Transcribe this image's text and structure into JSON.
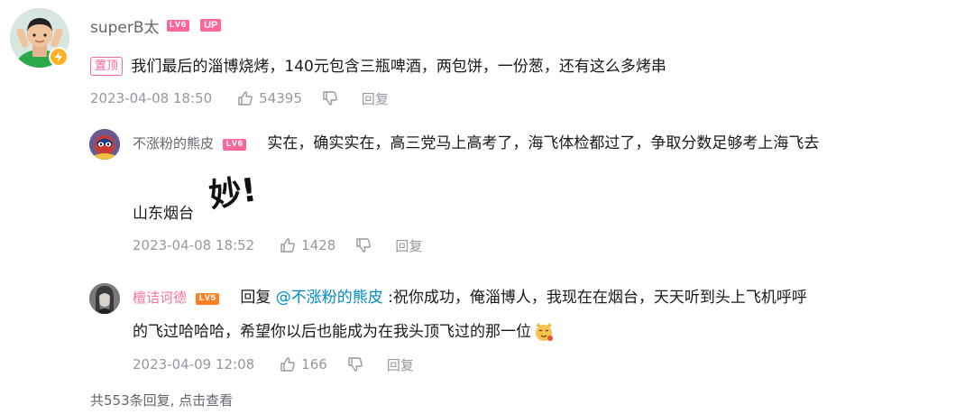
{
  "root": {
    "user": "superB太",
    "level": "LV6",
    "up_label": "UP",
    "pin_label": "置顶",
    "text": "我们最后的淄博烧烤，140元包含三瓶啤酒，两包饼，一份葱，还有这么多烤串",
    "date": "2023-04-08 18:50",
    "likes": "54395",
    "reply_label": "回复"
  },
  "replies": [
    {
      "user": "不涨粉的熊皮",
      "level": "LV6",
      "text_line1": "实在，确实实在，高三党马上高考了，海飞体检都过了，争取分数足够考上海飞去",
      "text_line2": "山东烟台",
      "sticker_text": "妙!",
      "date": "2023-04-08 18:52",
      "likes": "1428",
      "reply_label": "回复"
    },
    {
      "user": "檀诘诃德",
      "level": "LV5",
      "reply_prefix": "回复",
      "mention": "@不涨粉的熊皮",
      "text_line1": ":祝你成功，俺淄博人，我现在在烟台，天天听到头上飞机呼呼",
      "text_line2": "的飞过哈哈哈，希望你以后也能成为在我头顶飞过的那一位",
      "date": "2023-04-09 12:08",
      "likes": "166",
      "reply_label": "回复"
    }
  ],
  "footer": {
    "more_text": "共553条回复, 点击查看"
  },
  "colors": {
    "pink": "#fb7299",
    "gray_text": "#9499a0",
    "name_gray": "#61666d",
    "mention_blue": "#008ac5",
    "level_orange": "#ff7f24"
  }
}
